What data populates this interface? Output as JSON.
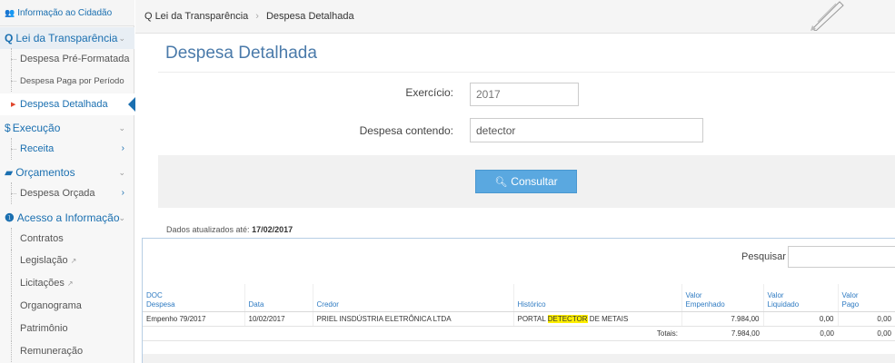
{
  "sidebar": {
    "top_label": "Informação ao Cidadão",
    "lei_transparencia": {
      "label": "Lei da Transparência",
      "items": [
        "Despesa Pré-Formatada",
        "Despesa Paga por Período",
        "Despesa Detalhada"
      ]
    },
    "execucao": {
      "label": "Execução",
      "items": [
        "Receita"
      ]
    },
    "orcamentos": {
      "label": "Orçamentos",
      "items": [
        "Despesa Orçada"
      ]
    },
    "acesso": {
      "label": "Acesso a Informação",
      "items": [
        "Contratos",
        "Legislação",
        "Licitações",
        "Organograma",
        "Patrimônio",
        "Remuneração"
      ]
    }
  },
  "breadcrumb": {
    "root": "Lei da Transparência",
    "current": "Despesa Detalhada"
  },
  "page_title": "Despesa Detalhada",
  "form": {
    "exercicio_label": "Exercício:",
    "exercicio_value": "2017",
    "despesa_label": "Despesa contendo:",
    "despesa_value": "detector",
    "submit_label": "Consultar"
  },
  "updated": {
    "prefix": "Dados atualizados até:",
    "date": "17/02/2017"
  },
  "results": {
    "search_label": "Pesquisar",
    "headers": {
      "doc": [
        "DOC",
        "Despesa"
      ],
      "data": "Data",
      "credor": "Credor",
      "historico": "Histórico",
      "empenhado": [
        "Valor",
        "Empenhado"
      ],
      "liquidado": [
        "Valor",
        "Liquidado"
      ],
      "pago": [
        "Valor",
        "Pago"
      ]
    },
    "rows": [
      {
        "doc": "Empenho 79/2017",
        "data": "10/02/2017",
        "credor": "PRIEL INSDÚSTRIA ELETRÔNICA LTDA",
        "historico_pre": "PORTAL ",
        "historico_hl": "DETECTOR",
        "historico_post": " DE METAIS",
        "empenhado": "7.984,00",
        "liquidado": "0,00",
        "pago": "0,00"
      }
    ],
    "totals": {
      "label": "Totais:",
      "empenhado": "7.984,00",
      "liquidado": "0,00",
      "pago": "0,00"
    }
  },
  "colors": {
    "accent": "#1a6fb0",
    "button": "#5aa8e0",
    "highlight": "#ffef00",
    "title": "#4a7aaa"
  }
}
